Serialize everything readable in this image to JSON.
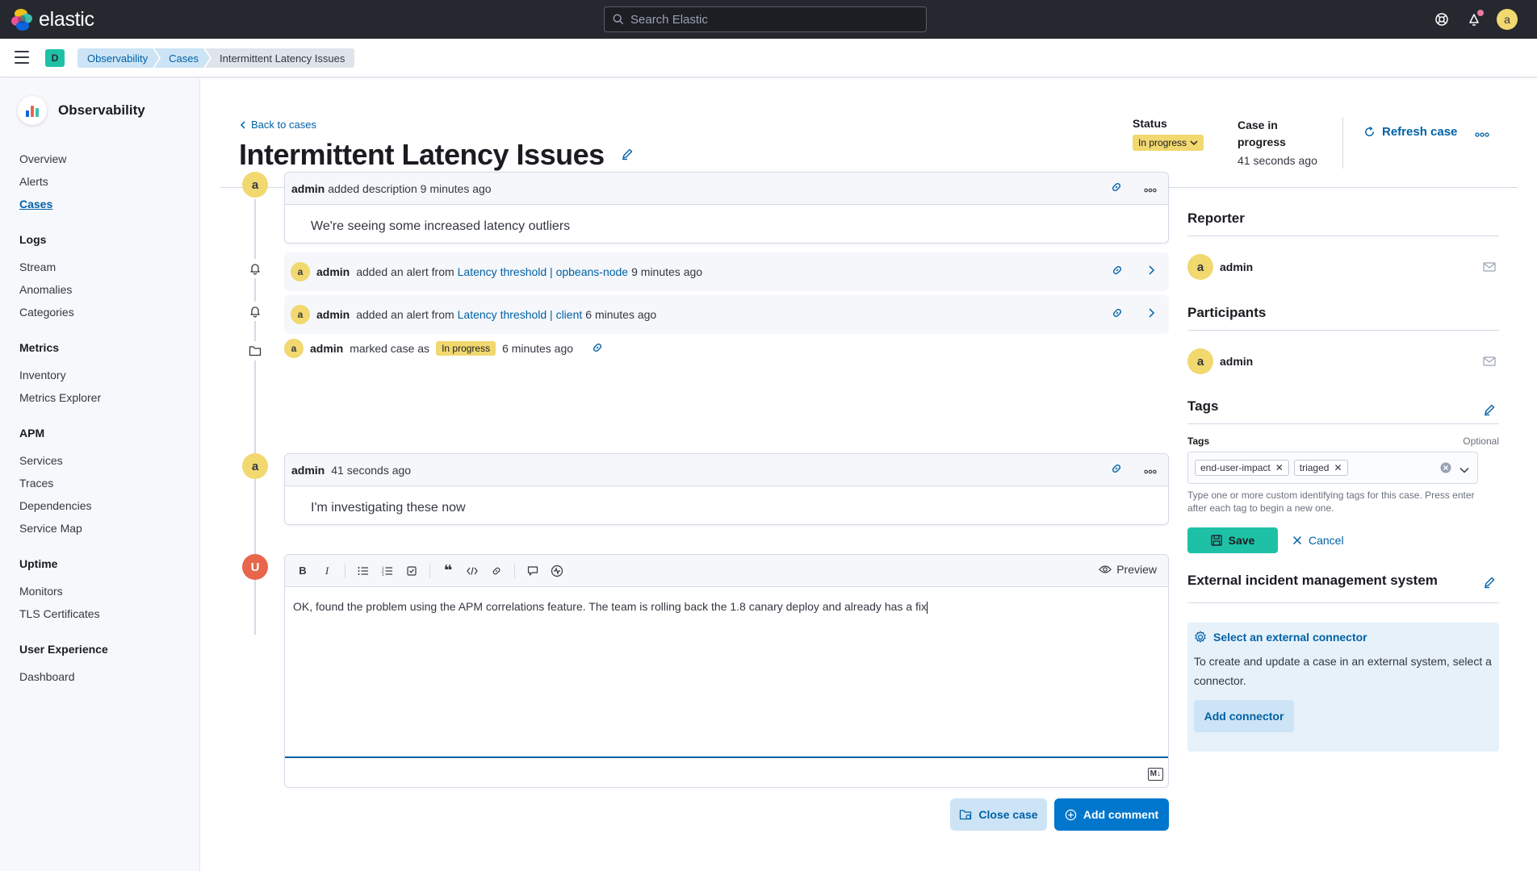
{
  "header": {
    "brand": "elastic",
    "search_placeholder": "Search Elastic",
    "user_initial": "a"
  },
  "breadcrumbs": {
    "space_initial": "D",
    "items": [
      "Observability",
      "Cases",
      "Intermittent Latency Issues"
    ]
  },
  "sidebar": {
    "title": "Observability",
    "top_items": [
      {
        "label": "Overview"
      },
      {
        "label": "Alerts"
      },
      {
        "label": "Cases",
        "active": true
      }
    ],
    "groups": [
      {
        "heading": "Logs",
        "items": [
          "Stream",
          "Anomalies",
          "Categories"
        ]
      },
      {
        "heading": "Metrics",
        "items": [
          "Inventory",
          "Metrics Explorer"
        ]
      },
      {
        "heading": "APM",
        "items": [
          "Services",
          "Traces",
          "Dependencies",
          "Service Map"
        ]
      },
      {
        "heading": "Uptime",
        "items": [
          "Monitors",
          "TLS Certificates"
        ]
      },
      {
        "heading": "User Experience",
        "items": [
          "Dashboard"
        ]
      }
    ]
  },
  "case": {
    "back_label": "Back to cases",
    "title": "Intermittent Latency Issues",
    "status_label": "Status",
    "status_value": "In progress",
    "inprogress_label": "Case in progress",
    "inprogress_time": "41 seconds ago",
    "refresh_label": "Refresh case"
  },
  "timeline": {
    "description": {
      "avatar": "a",
      "user": "admin",
      "action": "added description 9 minutes ago",
      "body": "We're seeing some increased latency outliers"
    },
    "alert1": {
      "avatar": "a",
      "user": "admin",
      "action": "added an alert from",
      "link": "Latency threshold | opbeans-node",
      "time": "9 minutes ago"
    },
    "alert2": {
      "avatar": "a",
      "user": "admin",
      "action": "added an alert from",
      "link": "Latency threshold | client",
      "time": "6 minutes ago"
    },
    "status_change": {
      "avatar": "a",
      "user": "admin",
      "action": "marked case as",
      "badge": "In progress",
      "time": "6 minutes ago"
    },
    "comment": {
      "avatar": "a",
      "user": "admin",
      "time": "41 seconds ago",
      "body": "I'm investigating these now"
    }
  },
  "editor": {
    "avatar": "U",
    "preview_label": "Preview",
    "text": "OK, found the problem using the APM correlations feature. The team is rolling back the 1.8 canary deploy and already has a fix",
    "md_badge": "M↓"
  },
  "actions": {
    "close_case": "Close case",
    "add_comment": "Add comment"
  },
  "right": {
    "reporter_title": "Reporter",
    "reporter_avatar": "a",
    "reporter_name": "admin",
    "participants_title": "Participants",
    "participant_avatar": "a",
    "participant_name": "admin",
    "tags_title": "Tags",
    "tags_label": "Tags",
    "tags_optional": "Optional",
    "tags": [
      "end-user-impact",
      "triaged"
    ],
    "tags_help": "Type one or more custom identifying tags for this case. Press enter after each tag to begin a new one.",
    "save_label": "Save",
    "cancel_label": "Cancel",
    "ext_title": "External incident management system",
    "ext_select": "Select an external connector",
    "ext_text": "To create and update a case in an external system, select a connector.",
    "add_connector": "Add connector"
  },
  "colors": {
    "accent": "#0077cc",
    "link": "#0061a6",
    "status_yellow": "#f1d86f",
    "success": "#1fc1a6",
    "header_bg": "#25282f"
  }
}
